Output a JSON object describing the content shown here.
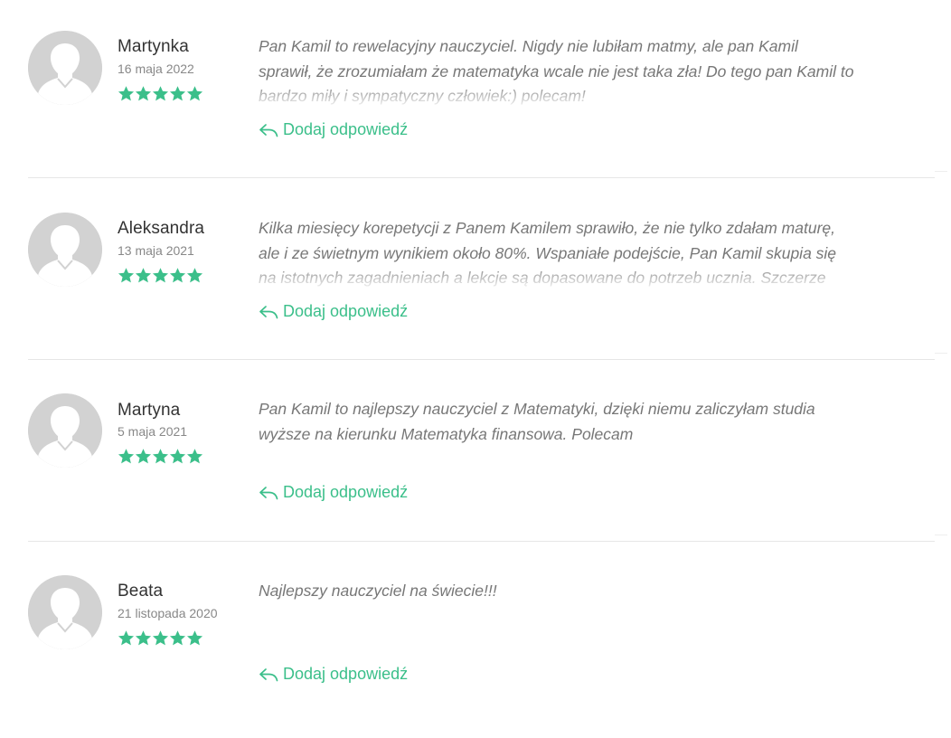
{
  "reviews": [
    {
      "author": "Martynka",
      "date": "16 maja 2022",
      "rating": 5,
      "text": "Pan Kamil to rewelacyjny nauczyciel. Nigdy nie lubiłam matmy, ale pan Kamil sprawił, że zrozumiałam że matematyka wcale nie jest taka zła! Do tego pan Kamil to bardzo miły i sympatyczny człowiek:) polecam!",
      "reply_label": "Dodaj odpowiedź"
    },
    {
      "author": "Aleksandra",
      "date": "13 maja 2021",
      "rating": 5,
      "text": "Kilka miesięcy korepetycji z Panem Kamilem sprawiło, że nie tylko zdałam maturę, ale i ze świetnym wynikiem około 80%. Wspaniałe podejście, Pan Kamil skupia się na istotnych zagadnieniach a lekcje są dopasowane do potrzeb ucznia. Szczerze",
      "reply_label": "Dodaj odpowiedź"
    },
    {
      "author": "Martyna",
      "date": "5 maja 2021",
      "rating": 5,
      "text": "Pan Kamil to najlepszy nauczyciel z Matematyki, dzięki niemu zaliczyłam studia wyższe na kierunku Matematyka finansowa. Polecam",
      "reply_label": "Dodaj odpowiedź"
    },
    {
      "author": "Beata",
      "date": "21 listopada 2020",
      "rating": 5,
      "text": "Najlepszy nauczyciel na świecie!!!",
      "reply_label": "Dodaj odpowiedź"
    }
  ],
  "colors": {
    "accent": "#3bbf8a",
    "star": "#3bbf8a",
    "avatar_bg": "#d2d2d2",
    "divider": "#e6e6e6"
  },
  "icons": {
    "avatar": "user-avatar-icon",
    "star": "star-icon",
    "reply": "reply-arrow-icon"
  }
}
